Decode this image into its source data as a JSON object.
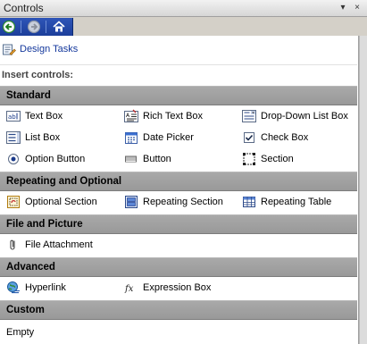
{
  "window": {
    "title": "Controls",
    "menu_glyph": "▾",
    "close_glyph": "×"
  },
  "nav": {
    "back_icon": "back-arrow-icon",
    "forward_icon": "forward-arrow-icon",
    "home_icon": "home-icon"
  },
  "design_tasks": {
    "label": "Design Tasks"
  },
  "insert_heading": "Insert controls:",
  "categories": {
    "standard": "Standard",
    "repeating": "Repeating and Optional",
    "file_picture": "File and Picture",
    "advanced": "Advanced",
    "custom": "Custom"
  },
  "standard": {
    "text_box": "Text Box",
    "rich_text_box": "Rich Text Box",
    "drop_down_list_box": "Drop-Down List Box",
    "list_box": "List Box",
    "date_picker": "Date Picker",
    "check_box": "Check Box",
    "option_button": "Option Button",
    "button": "Button",
    "section": "Section"
  },
  "repeating": {
    "optional_section": "Optional Section",
    "repeating_section": "Repeating Section",
    "repeating_table": "Repeating Table"
  },
  "file_picture": {
    "file_attachment": "File Attachment"
  },
  "advanced": {
    "hyperlink": "Hyperlink",
    "expression_box": "Expression Box"
  },
  "custom": {
    "empty_text": "Empty"
  },
  "colors": {
    "category_header": "#a3a3a3",
    "nav_bar": "#2a4fb2",
    "link": "#14389c"
  }
}
